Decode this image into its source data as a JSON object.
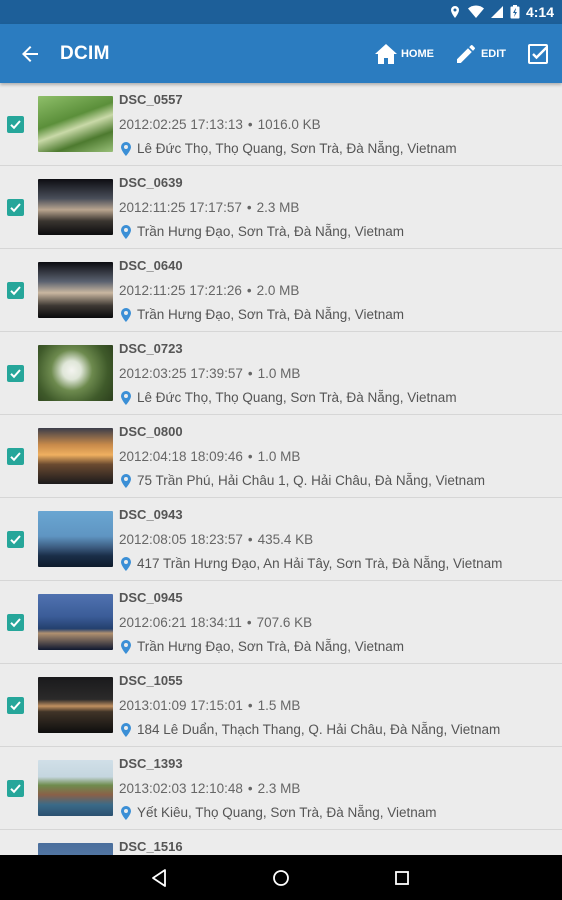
{
  "status_bar": {
    "time": "4:14"
  },
  "app_bar": {
    "title": "DCIM",
    "home_label": "HOME",
    "edit_label": "EDIT"
  },
  "colors": {
    "primary": "#2b7cc0",
    "status": "#1d5f99",
    "accent": "#26a69a",
    "pin": "#3b8fd6"
  },
  "photos": [
    {
      "name": "DSC_0557",
      "datetime": "2012:02:25 17:13:13",
      "size": "1016.0 KB",
      "location": "Lê Đức Thọ, Thọ Quang, Sơn Trà, Đà Nẵng, Vietnam",
      "checked": true
    },
    {
      "name": "DSC_0639",
      "datetime": "2012:11:25 17:17:57",
      "size": "2.3 MB",
      "location": "Trần Hưng Đạo, Sơn Trà, Đà Nẵng, Vietnam",
      "checked": true
    },
    {
      "name": "DSC_0640",
      "datetime": "2012:11:25 17:21:26",
      "size": "2.0 MB",
      "location": "Trần Hưng Đạo, Sơn Trà, Đà Nẵng, Vietnam",
      "checked": true
    },
    {
      "name": "DSC_0723",
      "datetime": "2012:03:25 17:39:57",
      "size": "1.0 MB",
      "location": "Lê Đức Thọ, Thọ Quang, Sơn Trà, Đà Nẵng, Vietnam",
      "checked": true
    },
    {
      "name": "DSC_0800",
      "datetime": "2012:04:18 18:09:46",
      "size": "1.0 MB",
      "location": "75 Trần Phú, Hải Châu 1, Q. Hải Châu, Đà Nẵng, Vietnam",
      "checked": true
    },
    {
      "name": "DSC_0943",
      "datetime": "2012:08:05 18:23:57",
      "size": "435.4 KB",
      "location": "417 Trần Hưng Đạo, An Hải Tây, Sơn Trà, Đà Nẵng, Vietnam",
      "checked": true
    },
    {
      "name": "DSC_0945",
      "datetime": "2012:06:21 18:34:11",
      "size": "707.6 KB",
      "location": "Trần Hưng Đạo, Sơn Trà, Đà Nẵng, Vietnam",
      "checked": true
    },
    {
      "name": "DSC_1055",
      "datetime": "2013:01:09 17:15:01",
      "size": "1.5 MB",
      "location": "184 Lê Duẩn, Thạch Thang, Q. Hải Châu, Đà Nẵng, Vietnam",
      "checked": true
    },
    {
      "name": "DSC_1393",
      "datetime": "2013:02:03 12:10:48",
      "size": "2.3 MB",
      "location": "Yết Kiêu, Thọ Quang, Sơn Trà, Đà Nẵng, Vietnam",
      "checked": true
    },
    {
      "name": "DSC_1516",
      "datetime": "",
      "size": "",
      "location": "",
      "checked": true
    }
  ]
}
